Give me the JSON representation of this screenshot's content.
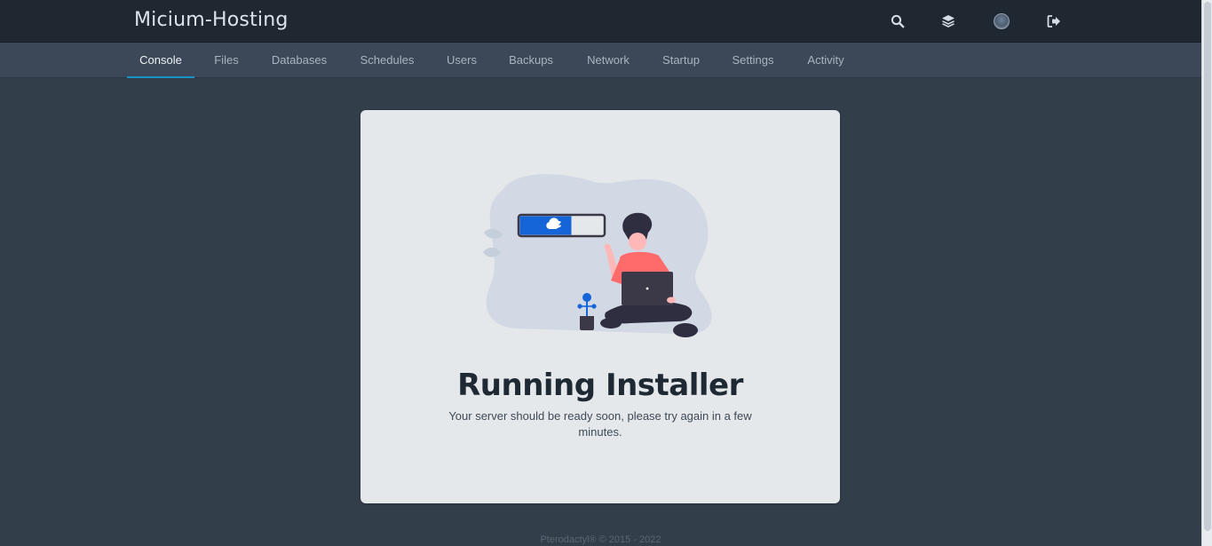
{
  "app": {
    "brand": "Micium-Hosting"
  },
  "topbar": {
    "icons": [
      "search-icon",
      "layers-icon",
      "avatar",
      "sign-out-icon"
    ]
  },
  "nav": {
    "tabs": [
      {
        "label": "Console",
        "active": true
      },
      {
        "label": "Files"
      },
      {
        "label": "Databases"
      },
      {
        "label": "Schedules"
      },
      {
        "label": "Users"
      },
      {
        "label": "Backups"
      },
      {
        "label": "Network"
      },
      {
        "label": "Startup"
      },
      {
        "label": "Settings"
      },
      {
        "label": "Activity"
      }
    ]
  },
  "status": {
    "title": "Running Installer",
    "message": "Your server should be ready soon, please try again in a few minutes."
  },
  "footer": {
    "text": "Pterodactyl® © 2015 - 2022"
  },
  "colors": {
    "page_bg": "#333e4b",
    "topbar_bg": "#1f2731",
    "navbar_bg": "#3c4857",
    "accent": "#1992c4",
    "card_bg": "#e5e8eb",
    "illustration_blue": "#1565d8"
  }
}
